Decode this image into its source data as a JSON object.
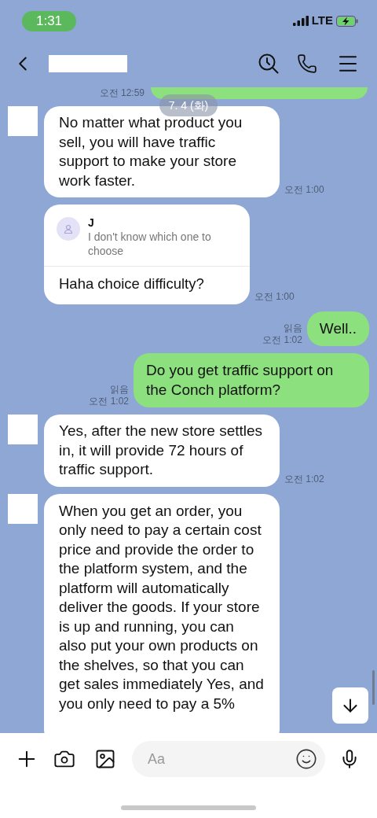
{
  "status_bar": {
    "time": "1:31",
    "network": "LTE"
  },
  "previous_message": {
    "time": "오전 12:59"
  },
  "date_divider": "7. 4 (화)",
  "messages": [
    {
      "kind": "incoming",
      "text": "No matter what product you sell, you will have traffic support to make your store work faster.",
      "time": "오전 1:00"
    },
    {
      "kind": "reply",
      "quote_author": "J",
      "quote": "I don't know which one to choose",
      "text": "Haha choice difficulty?",
      "time": "오전 1:00"
    },
    {
      "kind": "outgoing",
      "text": "Well..",
      "read": "읽음",
      "time": "오전 1:02"
    },
    {
      "kind": "outgoing",
      "text": "Do you get traffic support on the Conch platform?",
      "read": "읽음",
      "time": "오전 1:02"
    },
    {
      "kind": "incoming",
      "text": "Yes, after the new store settles in, it will provide 72 hours of traffic support.",
      "time": "오전 1:02"
    },
    {
      "kind": "incoming",
      "text": "When you get an order, you only need to pay a certain cost price and provide the order to the platform system, and the platform will automatically deliver the goods. If your store is up and running, you can also put your own products on the shelves, so that you can get sales immediately Yes, and you only need to pay a 5%"
    }
  ],
  "composer": {
    "placeholder": "Aa"
  }
}
